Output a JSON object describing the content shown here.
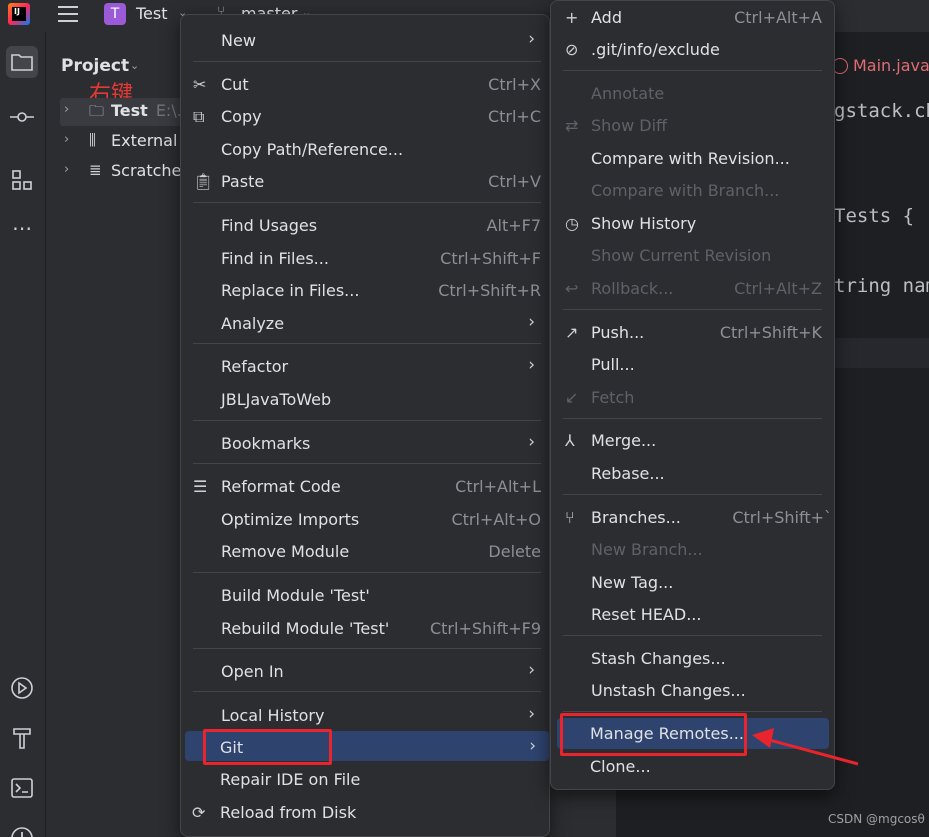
{
  "topbar": {
    "logo_text": "IJ",
    "project_badge": "T",
    "project_name": "Test",
    "branch_name": "master"
  },
  "project_panel": {
    "title": "Project",
    "annotation": "右键",
    "tree": [
      {
        "label": "Test",
        "path": "E:\\..."
      },
      {
        "label": "External",
        "path": ""
      },
      {
        "label": "Scratche",
        "path": ""
      }
    ]
  },
  "editor": {
    "tab": "Main.java",
    "code_lines": [
      "gstack.ch",
      "Tests {",
      "tring nam"
    ]
  },
  "context_menu": {
    "items": [
      {
        "label": "New",
        "shortcut": "",
        "submenu": true
      },
      {
        "label": "Cut",
        "shortcut": "Ctrl+X"
      },
      {
        "label": "Copy",
        "shortcut": "Ctrl+C"
      },
      {
        "label": "Copy Path/Reference...",
        "shortcut": ""
      },
      {
        "label": "Paste",
        "shortcut": "Ctrl+V"
      },
      {
        "label": "Find Usages",
        "shortcut": "Alt+F7"
      },
      {
        "label": "Find in Files...",
        "shortcut": "Ctrl+Shift+F"
      },
      {
        "label": "Replace in Files...",
        "shortcut": "Ctrl+Shift+R"
      },
      {
        "label": "Analyze",
        "shortcut": "",
        "submenu": true
      },
      {
        "label": "Refactor",
        "shortcut": "",
        "submenu": true
      },
      {
        "label": "JBLJavaToWeb",
        "shortcut": ""
      },
      {
        "label": "Bookmarks",
        "shortcut": "",
        "submenu": true
      },
      {
        "label": "Reformat Code",
        "shortcut": "Ctrl+Alt+L"
      },
      {
        "label": "Optimize Imports",
        "shortcut": "Ctrl+Alt+O"
      },
      {
        "label": "Remove Module",
        "shortcut": "Delete"
      },
      {
        "label": "Build Module 'Test'",
        "shortcut": ""
      },
      {
        "label": "Rebuild Module 'Test'",
        "shortcut": "Ctrl+Shift+F9"
      },
      {
        "label": "Open In",
        "shortcut": "",
        "submenu": true
      },
      {
        "label": "Local History",
        "shortcut": "",
        "submenu": true
      },
      {
        "label": "Git",
        "shortcut": "",
        "submenu": true
      },
      {
        "label": "Repair IDE on File",
        "shortcut": ""
      },
      {
        "label": "Reload from Disk",
        "shortcut": ""
      }
    ]
  },
  "git_menu": {
    "items": [
      {
        "label": "Add",
        "shortcut": "Ctrl+Alt+A"
      },
      {
        "label": ".git/info/exclude",
        "shortcut": ""
      },
      {
        "label": "Annotate",
        "shortcut": ""
      },
      {
        "label": "Show Diff",
        "shortcut": ""
      },
      {
        "label": "Compare with Revision...",
        "shortcut": ""
      },
      {
        "label": "Compare with Branch...",
        "shortcut": ""
      },
      {
        "label": "Show History",
        "shortcut": ""
      },
      {
        "label": "Show Current Revision",
        "shortcut": ""
      },
      {
        "label": "Rollback...",
        "shortcut": "Ctrl+Alt+Z"
      },
      {
        "label": "Push...",
        "shortcut": "Ctrl+Shift+K"
      },
      {
        "label": "Pull...",
        "shortcut": ""
      },
      {
        "label": "Fetch",
        "shortcut": ""
      },
      {
        "label": "Merge...",
        "shortcut": ""
      },
      {
        "label": "Rebase...",
        "shortcut": ""
      },
      {
        "label": "Branches...",
        "shortcut": "Ctrl+Shift+`"
      },
      {
        "label": "New Branch...",
        "shortcut": ""
      },
      {
        "label": "New Tag...",
        "shortcut": ""
      },
      {
        "label": "Reset HEAD...",
        "shortcut": ""
      },
      {
        "label": "Stash Changes...",
        "shortcut": ""
      },
      {
        "label": "Unstash Changes...",
        "shortcut": ""
      },
      {
        "label": "Manage Remotes...",
        "shortcut": ""
      },
      {
        "label": "Clone...",
        "shortcut": ""
      }
    ]
  },
  "watermark": "CSDN @mgcosθ",
  "colors": {
    "accent_highlight": "#2e436e",
    "annotation_red": "#e8242c"
  }
}
